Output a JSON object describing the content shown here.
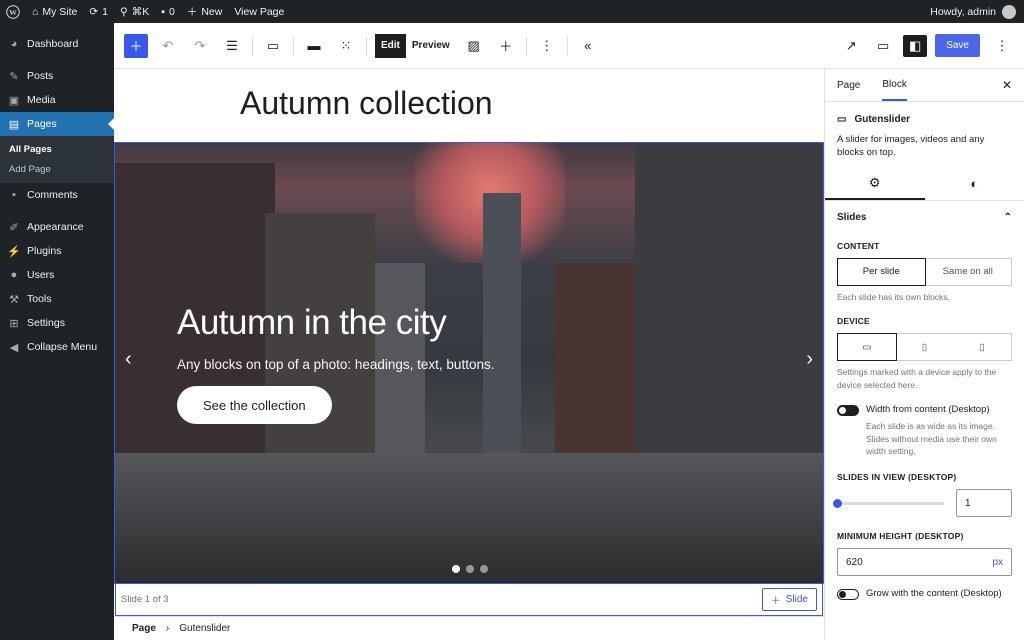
{
  "adminbar": {
    "site": "My Site",
    "updates": "1",
    "shortcut": "⌘K",
    "comments": "0",
    "new": "New",
    "view": "View Page",
    "howdy": "Howdy, admin"
  },
  "sidebar": {
    "items": [
      {
        "label": "Dashboard",
        "icon": "dashboard-icon"
      },
      {
        "label": "Posts",
        "icon": "pin-icon"
      },
      {
        "label": "Media",
        "icon": "media-icon"
      },
      {
        "label": "Pages",
        "icon": "pages-icon"
      },
      {
        "label": "Comments",
        "icon": "comment-icon"
      },
      {
        "label": "Appearance",
        "icon": "brush-icon"
      },
      {
        "label": "Plugins",
        "icon": "plugin-icon"
      },
      {
        "label": "Users",
        "icon": "user-icon"
      },
      {
        "label": "Tools",
        "icon": "wrench-icon"
      },
      {
        "label": "Settings",
        "icon": "settings-icon"
      },
      {
        "label": "Collapse Menu",
        "icon": "collapse-icon"
      }
    ],
    "sub": [
      "All Pages",
      "Add Page"
    ]
  },
  "toolbar": {
    "edit": "Edit",
    "preview": "Preview",
    "save": "Save"
  },
  "canvas": {
    "title": "Autumn collection",
    "slide_heading": "Autumn in the city",
    "slide_text": "Any blocks on top of a photo: headings, text, buttons.",
    "slide_button": "See the collection",
    "slide_counter": "Slide 1 of 3",
    "add_slide": "Slide"
  },
  "breadcrumb": {
    "page": "Page",
    "block": "Gutenslider"
  },
  "panel": {
    "tab_page": "Page",
    "tab_block": "Block",
    "block_name": "Gutenslider",
    "block_desc": "A slider for images, videos and any blocks on top.",
    "section": "Slides",
    "content_label": "Content",
    "per_slide": "Per slide",
    "same_on_all": "Same on all",
    "content_help": "Each slide has its own blocks.",
    "device_label": "Device",
    "device_help": "Settings marked with a device apply to the device selected here.",
    "width_toggle": "Width from content (Desktop)",
    "width_help": "Each slide is as wide as its image. Slides without media use their own width setting.",
    "slides_in_view_label": "Slides in view (Desktop)",
    "slides_in_view": "1",
    "min_height_label": "Minimum height (Desktop)",
    "min_height": "620",
    "min_height_unit": "px",
    "grow_toggle": "Grow with the content (Desktop)"
  },
  "colors": {
    "accent": "#3858e9",
    "admin_bg": "#1d2327",
    "active": "#2271b1"
  }
}
